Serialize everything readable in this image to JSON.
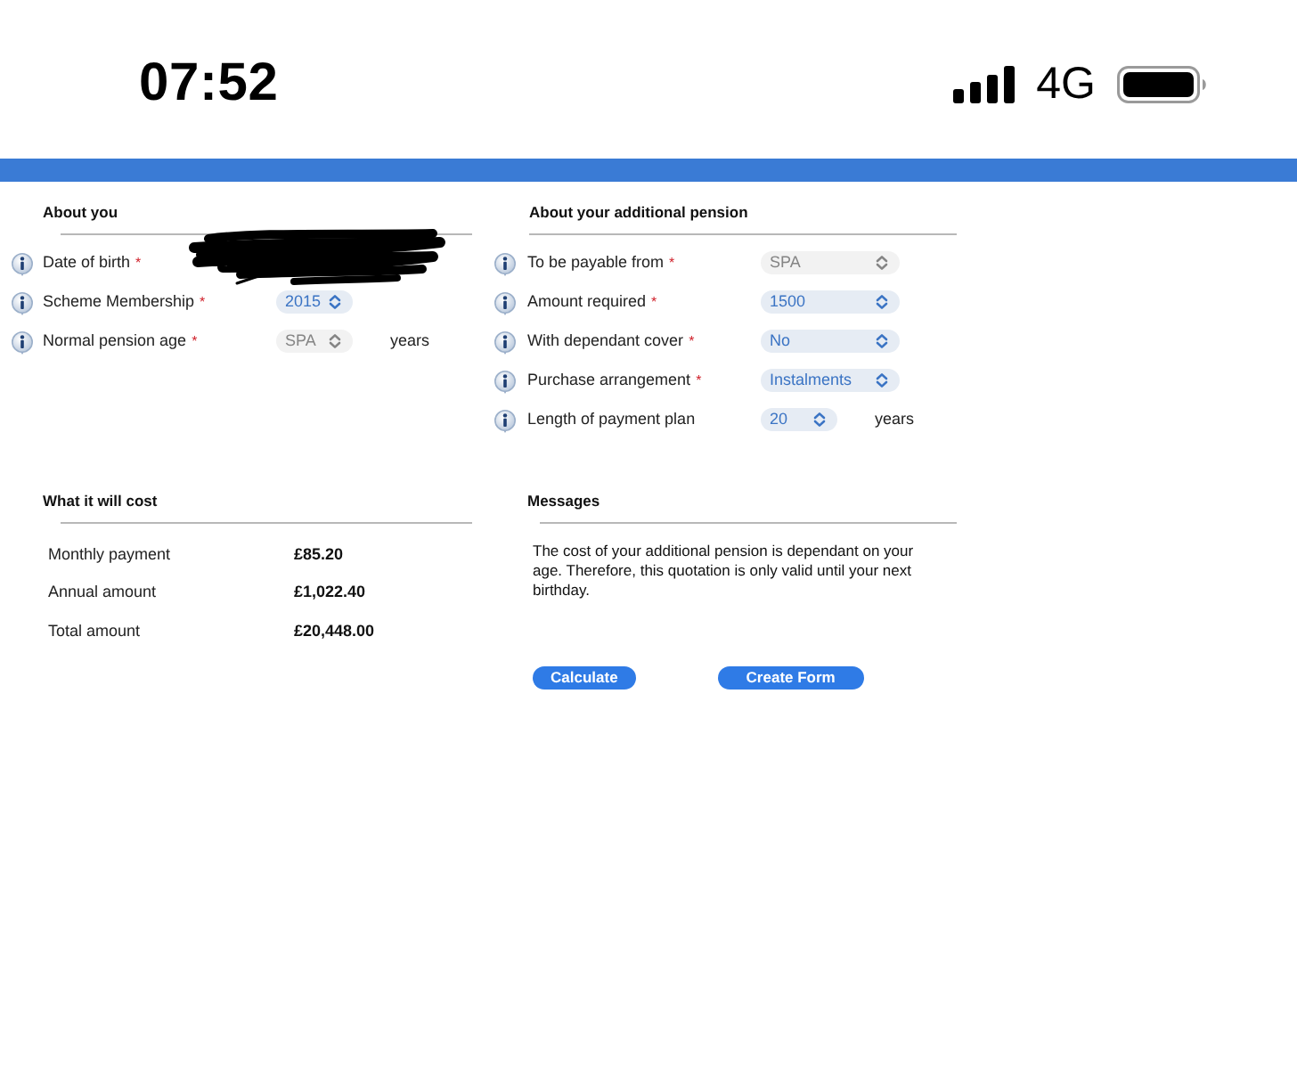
{
  "status_bar": {
    "time": "07:52",
    "network": "4G"
  },
  "about_you": {
    "heading": "About you",
    "fields": [
      {
        "kind": "redacted",
        "label": "Date of birth",
        "required_mark": "*"
      },
      {
        "kind": "select",
        "label": "Scheme Membership",
        "required_mark": "*",
        "value": "2015",
        "disabled": false
      },
      {
        "kind": "select",
        "label": "Normal pension age",
        "required_mark": "*",
        "value": "SPA",
        "disabled": true,
        "unit": "years"
      }
    ]
  },
  "additional_pension": {
    "heading": "About your additional pension",
    "fields": [
      {
        "kind": "select",
        "label": "To be payable from",
        "required_mark": "*",
        "value": "SPA",
        "disabled": true
      },
      {
        "kind": "select",
        "label": "Amount required",
        "required_mark": "*",
        "value": "1500",
        "disabled": false
      },
      {
        "kind": "select",
        "label": "With dependant cover",
        "required_mark": "*",
        "value": "No",
        "disabled": false
      },
      {
        "kind": "select",
        "label": "Purchase arrangement",
        "required_mark": "*",
        "value": "Instalments",
        "disabled": false
      },
      {
        "kind": "select",
        "label": "Length of payment plan",
        "value": "20",
        "disabled": false,
        "unit": "years"
      }
    ]
  },
  "cost": {
    "heading": "What it will cost",
    "rows": [
      {
        "label": "Monthly payment",
        "value": "£85.20"
      },
      {
        "label": "Annual amount",
        "value": "£1,022.40"
      },
      {
        "label": "Total amount",
        "value": "£20,448.00"
      }
    ]
  },
  "messages": {
    "heading": "Messages",
    "text": "The cost of your additional pension is dependant on your age. Therefore, this quotation is only valid until your next birthday."
  },
  "buttons": [
    {
      "label": "Calculate"
    },
    {
      "label": "Create Form"
    }
  ]
}
